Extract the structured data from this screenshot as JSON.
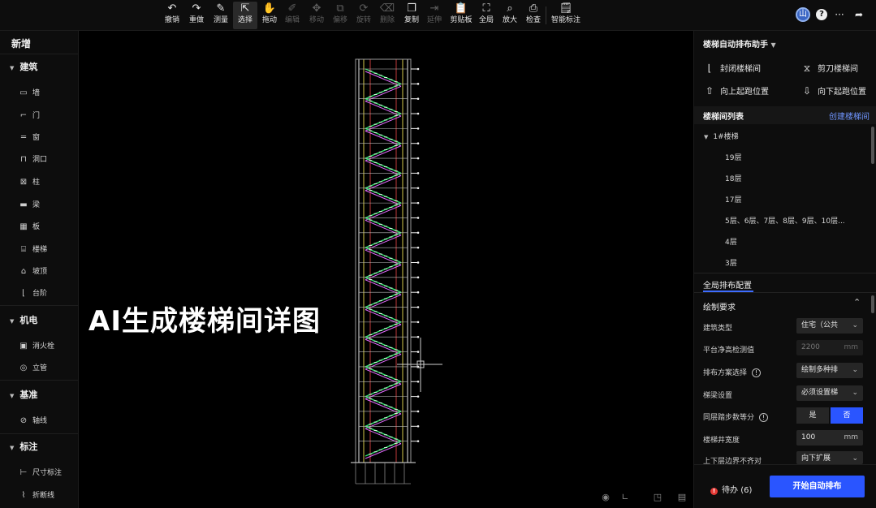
{
  "toolbar": {
    "undo": "撤销",
    "redo": "重做",
    "measure": "测量",
    "select": "选择",
    "pan": "拖动",
    "edit": "编辑",
    "move": "移动",
    "offset": "偏移",
    "rotate": "旋转",
    "delete": "删除",
    "copy": "复制",
    "extend": "延伸",
    "clipboard": "剪贴板",
    "fit_all": "全局",
    "zoom_in": "放大",
    "inspect": "检查",
    "smart_dim": "智能标注"
  },
  "header_right": {
    "avatar_letter": "山",
    "help": "?",
    "more": "···",
    "share": "➦"
  },
  "left": {
    "title": "新增",
    "sections": {
      "arch": "建筑",
      "mep": "机电",
      "datum": "基准",
      "annot": "标注"
    },
    "items": {
      "wall": "墙",
      "door": "门",
      "window": "窗",
      "opening": "洞口",
      "column": "柱",
      "beam": "梁",
      "slab": "板",
      "stair": "楼梯",
      "roof": "坡顶",
      "step": "台阶",
      "hydrant": "消火栓",
      "riser": "立管",
      "axis": "轴线",
      "dimension": "尺寸标注",
      "breakline": "折断线"
    }
  },
  "canvas": {
    "overlay_title": "AI生成楼梯间详图"
  },
  "right": {
    "title": "楼梯自动排布助手",
    "actions": {
      "closed": "封闭楼梯间",
      "scissor": "剪刀楼梯间",
      "up_start": "向上起跑位置",
      "down_start": "向下起跑位置"
    },
    "list_header": "楼梯间列表",
    "create_link": "创建楼梯间",
    "tree": {
      "root": "1#楼梯",
      "floors": [
        "19层",
        "18层",
        "17层",
        "5层、6层、7层、8层、9层、10层...",
        "4层",
        "3层"
      ]
    },
    "config_tab": "全局排布配置",
    "group": "绘制要求",
    "fields": {
      "building_type": {
        "label": "建筑类型",
        "value": "住宅（公共"
      },
      "clear_height": {
        "label": "平台净高检测值",
        "value": "2200",
        "unit": "mm"
      },
      "scheme": {
        "label": "排布方案选择",
        "value": "绘制多种排"
      },
      "beam": {
        "label": "梯梁设置",
        "value": "必须设置梯"
      },
      "equal_steps": {
        "label": "同层踏步数等分",
        "yes": "是",
        "no": "否"
      },
      "well_width": {
        "label": "楼梯井宽度",
        "value": "100",
        "unit": "mm"
      },
      "misalign": {
        "label": "上下层边界不齐对",
        "value": "向下扩展"
      }
    },
    "todo": {
      "label": "待办",
      "count": "(6)"
    },
    "start_button": "开始自动排布"
  },
  "colors": {
    "accent": "#2a55ff",
    "link": "#6f95ff",
    "alert": "#e53935"
  }
}
